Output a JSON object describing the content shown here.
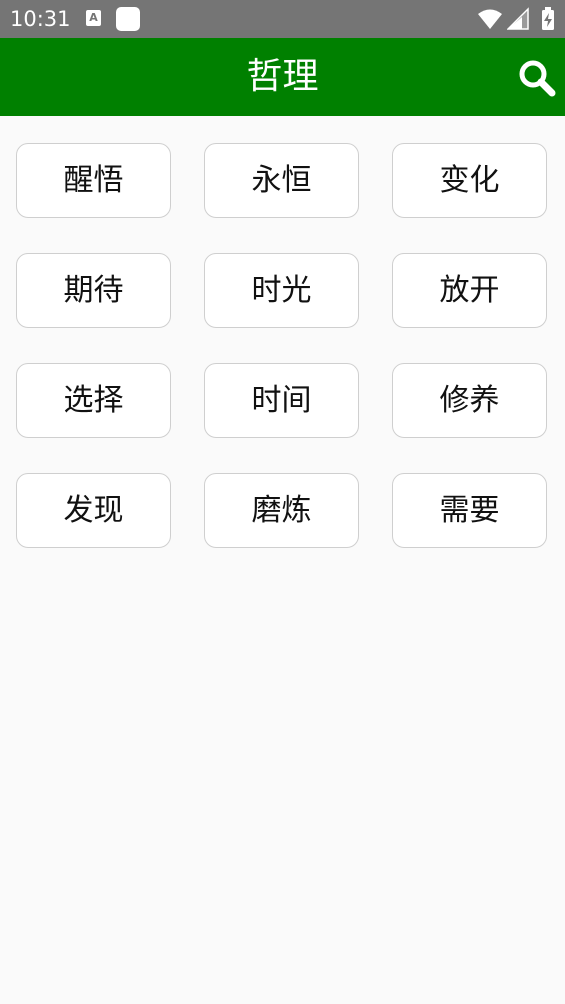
{
  "status_bar": {
    "time": "10:31",
    "a_icon_label": "A"
  },
  "app_bar": {
    "title": "哲理",
    "color": "#008000"
  },
  "categories": [
    [
      "醒悟",
      "永恒",
      "变化"
    ],
    [
      "期待",
      "时光",
      "放开"
    ],
    [
      "选择",
      "时间",
      "修养"
    ],
    [
      "发现",
      "磨炼",
      "需要"
    ]
  ]
}
